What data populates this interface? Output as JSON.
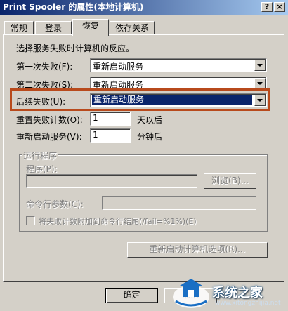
{
  "window": {
    "title": "Print Spooler 的属性(本地计算机)",
    "help_btn": "?",
    "close_btn": "×"
  },
  "tabs": [
    "常规",
    "登录",
    "恢复",
    "依存关系"
  ],
  "recovery": {
    "intro": "选择服务失败时计算机的反应。",
    "first_failure_label": "第一次失败(F):",
    "first_failure_value": "重新启动服务",
    "second_failure_label": "第二次失败(S):",
    "second_failure_value": "重新启动服务",
    "subsequent_failure_label": "后续失败(U):",
    "subsequent_failure_value": "重新启动服务",
    "reset_count_label": "重置失败计数(O):",
    "reset_count_value": "1",
    "reset_count_unit": "天以后",
    "restart_service_label": "重新启动服务(V):",
    "restart_service_value": "1",
    "restart_service_unit": "分钟后"
  },
  "run_program": {
    "group_title": "运行程序",
    "program_label": "程序(P):",
    "program_value": "",
    "browse_button": "浏览(B)...",
    "params_label": "命令行参数(C):",
    "params_value": "",
    "append_fail_checkbox": "将失败计数附加到命令行结尾(/fail=%1%)(E)"
  },
  "restart_options_button": "重新启动计算机选项(R)...",
  "footer": {
    "ok_button": "确定",
    "cancel_button": "取消"
  },
  "watermark": {
    "name": "系统之家",
    "url": "www.xitongzhijia.net"
  }
}
